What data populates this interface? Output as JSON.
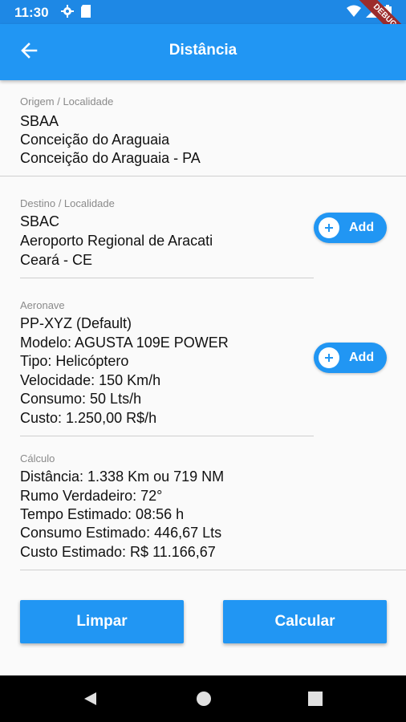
{
  "status_bar": {
    "time": "11:30",
    "icons": [
      "gear-icon",
      "sd-card-icon",
      "wifi-icon",
      "signal-icon",
      "battery-icon"
    ]
  },
  "debug_banner": "DEBUG",
  "app_bar": {
    "title": "Distância"
  },
  "origem": {
    "label": "Origem / Localidade",
    "code": "SBAA",
    "name": "Conceição do Araguaia",
    "city": "Conceição do Araguaia - PA"
  },
  "destino": {
    "label": "Destino / Localidade",
    "code": "SBAC",
    "name": "Aeroporto Regional de Aracati",
    "city": "Ceará - CE",
    "add_label": "Add"
  },
  "aeronave": {
    "label": "Aeronave",
    "prefix": "PP-XYZ (Default)",
    "modelo": "Modelo: AGUSTA 109E POWER",
    "tipo": "Tipo: Helicóptero",
    "velocidade": "Velocidade: 150 Km/h",
    "consumo": "Consumo: 50 Lts/h",
    "custo": "Custo: 1.250,00 R$/h",
    "add_label": "Add"
  },
  "calculo": {
    "label": "Cálculo",
    "distancia": "Distância: 1.338 Km ou 719 NM",
    "rumo": "Rumo Verdadeiro: 72°",
    "tempo": "Tempo Estimado: 08:56 h",
    "consumo": "Consumo Estimado: 446,67 Lts",
    "custo": "Custo Estimado: R$ 11.166,67"
  },
  "buttons": {
    "limpar": "Limpar",
    "calcular": "Calcular"
  },
  "colors": {
    "primary": "#2196f3",
    "status_bar": "#1e88e5",
    "debug": "#9c2c2c"
  }
}
